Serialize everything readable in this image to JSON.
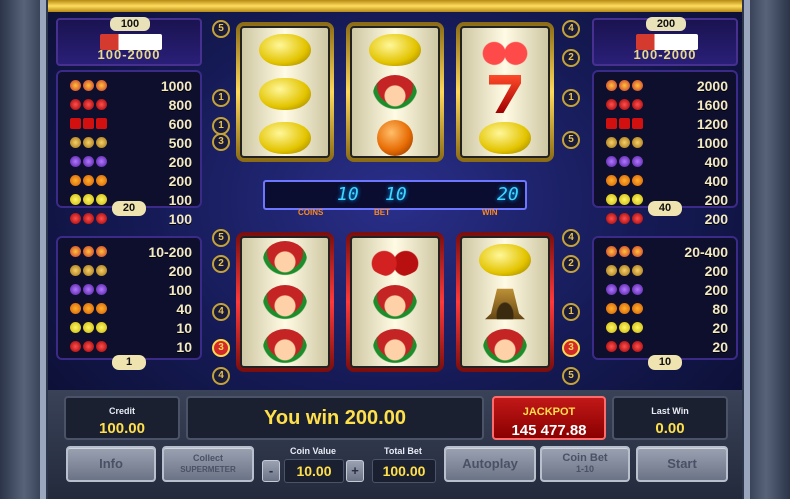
{
  "colors": {
    "gold": "#ffd959",
    "jackpot_red": "#c11818",
    "value_yellow": "#ffe04a",
    "meter_cyan": "#3fd6ff"
  },
  "upper": {
    "jackpot_left": {
      "header": "100",
      "range": "100-2000"
    },
    "jackpot_right": {
      "header": "200",
      "range": "100-2000"
    },
    "paytable_left": {
      "rows": [
        {
          "symbols": "joker",
          "value": "1000"
        },
        {
          "symbols": "cherry",
          "value": "800"
        },
        {
          "symbols": "seven",
          "value": "600"
        },
        {
          "symbols": "bell",
          "value": "500"
        },
        {
          "symbols": "plum",
          "value": "200"
        },
        {
          "symbols": "orange",
          "value": "200"
        },
        {
          "symbols": "lemon",
          "value": "100"
        },
        {
          "symbols": "cherry",
          "value": "100"
        }
      ],
      "badge": "20"
    },
    "paytable_right": {
      "rows": [
        {
          "symbols": "joker",
          "value": "2000"
        },
        {
          "symbols": "cherry",
          "value": "1600"
        },
        {
          "symbols": "seven",
          "value": "1200"
        },
        {
          "symbols": "bell",
          "value": "1000"
        },
        {
          "symbols": "plum",
          "value": "400"
        },
        {
          "symbols": "orange",
          "value": "400"
        },
        {
          "symbols": "lemon",
          "value": "200"
        },
        {
          "symbols": "cherry",
          "value": "200"
        }
      ],
      "badge": "40"
    },
    "reels": [
      [
        "lemon",
        "lemon",
        "lemon"
      ],
      [
        "lemon",
        "joker",
        "orange"
      ],
      [
        "cherry",
        "seven",
        "lemon"
      ]
    ],
    "line_numbers_left": [
      "5",
      "1",
      "1",
      "3"
    ],
    "line_numbers_right": [
      "4",
      "2",
      "1",
      "5"
    ],
    "meter": {
      "coins": "10",
      "bet": "10",
      "win": "20",
      "coins_label": "COINS",
      "bet_label": "BET",
      "win_label": "WIN"
    }
  },
  "lower": {
    "paytable_left": {
      "header_value": "10-200",
      "rows": [
        {
          "symbols": "bell",
          "value": "200"
        },
        {
          "symbols": "plum",
          "value": "100"
        },
        {
          "symbols": "orange",
          "value": "40"
        },
        {
          "symbols": "lemon",
          "value": "10"
        },
        {
          "symbols": "cherry",
          "value": "10"
        }
      ],
      "badge": "1"
    },
    "paytable_right": {
      "header_value": "20-400",
      "rows": [
        {
          "symbols": "bell",
          "value": "200"
        },
        {
          "symbols": "plum",
          "value": "200"
        },
        {
          "symbols": "orange",
          "value": "80"
        },
        {
          "symbols": "lemon",
          "value": "20"
        },
        {
          "symbols": "cherry",
          "value": "20"
        }
      ],
      "badge": "10"
    },
    "reels": [
      [
        "joker",
        "joker",
        "joker"
      ],
      [
        "tomato",
        "joker",
        "joker"
      ],
      [
        "lemon",
        "bell",
        "joker"
      ]
    ],
    "line_numbers_left": [
      "5",
      "2",
      "4",
      "3",
      "4"
    ],
    "line_numbers_right": [
      "4",
      "2",
      "1",
      "3",
      "5"
    ]
  },
  "console": {
    "credit_label": "Credit",
    "credit_value": "100.00",
    "win_message": "You win 200.00",
    "jackpot_label": "JACKPOT",
    "jackpot_value": "145 477.88",
    "last_win_label": "Last Win",
    "last_win_value": "0.00",
    "coin_value_label": "Coin Value",
    "coin_value": "10.00",
    "total_bet_label": "Total Bet",
    "total_bet": "100.00",
    "minus": "-",
    "plus": "+",
    "buttons": {
      "info": "Info",
      "collect_line1": "Collect",
      "collect_line2": "SUPERMETER",
      "autoplay": "Autoplay",
      "coin_bet_line1": "Coin Bet",
      "coin_bet_line2": "1-10",
      "start": "Start"
    }
  }
}
